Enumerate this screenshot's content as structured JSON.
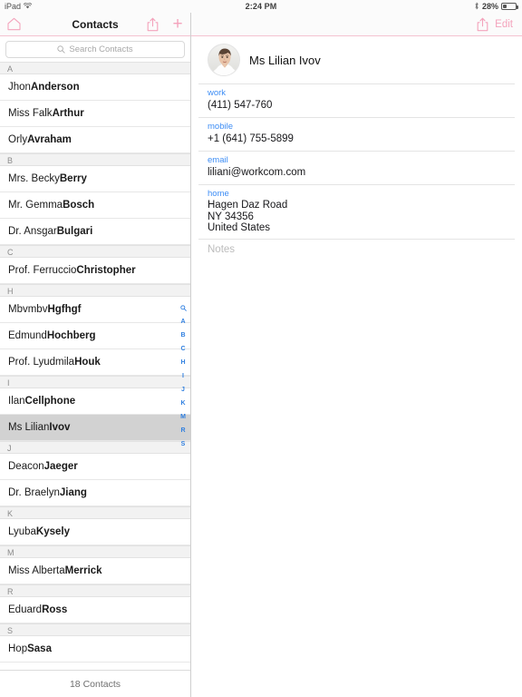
{
  "statusbar": {
    "device": "iPad",
    "wifi_icon": "wifi-icon",
    "time": "2:24 PM",
    "bluetooth_icon": "bluetooth-icon",
    "battery_percent": "28%",
    "battery_level": 28
  },
  "master": {
    "navbar": {
      "home_icon": "home-icon",
      "title": "Contacts",
      "share_icon": "share-icon",
      "add_label": "+"
    },
    "search": {
      "icon": "search-icon",
      "placeholder": "Search Contacts"
    },
    "sections": [
      {
        "letter": "A",
        "contacts": [
          {
            "first": "Jhon ",
            "last": "Anderson",
            "selected": false
          },
          {
            "first": "Miss Falk ",
            "last": "Arthur",
            "selected": false
          },
          {
            "first": "Orly ",
            "last": "Avraham",
            "selected": false
          }
        ]
      },
      {
        "letter": "B",
        "contacts": [
          {
            "first": "Mrs. Becky ",
            "last": "Berry",
            "selected": false
          },
          {
            "first": "Mr. Gemma ",
            "last": "Bosch",
            "selected": false
          },
          {
            "first": "Dr. Ansgar ",
            "last": "Bulgari",
            "selected": false
          }
        ]
      },
      {
        "letter": "C",
        "contacts": [
          {
            "first": "Prof. Ferruccio ",
            "last": "Christopher",
            "selected": false
          }
        ]
      },
      {
        "letter": "H",
        "contacts": [
          {
            "first": "Mbvmbv ",
            "last": "Hgfhgf",
            "selected": false
          },
          {
            "first": "Edmund ",
            "last": "Hochberg",
            "selected": false
          },
          {
            "first": "Prof. Lyudmila ",
            "last": "Houk",
            "selected": false
          }
        ]
      },
      {
        "letter": "I",
        "contacts": [
          {
            "first": "Ilan ",
            "last": "Cellphone",
            "selected": false
          },
          {
            "first": "Ms Lilian ",
            "last": "Ivov",
            "selected": true
          }
        ]
      },
      {
        "letter": "J",
        "contacts": [
          {
            "first": "Deacon ",
            "last": "Jaeger",
            "selected": false
          },
          {
            "first": "Dr. Braelyn ",
            "last": "Jiang",
            "selected": false
          }
        ]
      },
      {
        "letter": "K",
        "contacts": [
          {
            "first": "Lyuba ",
            "last": "Kysely",
            "selected": false
          }
        ]
      },
      {
        "letter": "M",
        "contacts": [
          {
            "first": "Miss Alberta ",
            "last": "Merrick",
            "selected": false
          }
        ]
      },
      {
        "letter": "R",
        "contacts": [
          {
            "first": "Eduard ",
            "last": "Ross",
            "selected": false
          }
        ]
      },
      {
        "letter": "S",
        "contacts": [
          {
            "first": "Hop ",
            "last": "Sasa",
            "selected": false
          }
        ]
      }
    ],
    "index_strip": [
      "search-icon",
      "A",
      "B",
      "C",
      "H",
      "I",
      "J",
      "K",
      "M",
      "R",
      "S"
    ],
    "footer": "18 Contacts"
  },
  "detail": {
    "navbar": {
      "share_icon": "share-icon",
      "edit_label": "Edit"
    },
    "avatar": "contact-photo",
    "name": "Ms Lilian Ivov",
    "fields": [
      {
        "label": "work",
        "value": "(411) 547-760",
        "type": "phone"
      },
      {
        "label": "mobile",
        "value": "+1 (641) 755-5899",
        "type": "phone"
      },
      {
        "label": "email",
        "value": "liliani@workcom.com",
        "type": "email"
      }
    ],
    "address": {
      "label": "home",
      "lines": [
        "Hagen Daz Road",
        " NY 34356",
        "United States"
      ]
    },
    "notes": {
      "label": "Notes",
      "value": ""
    }
  },
  "colors": {
    "accent_pink": "#f4a3bc",
    "link_blue": "#3d8df5",
    "index_blue": "#2f7fe0",
    "selected_row": "#d2d2d2",
    "section_header_bg": "#f2f2f2"
  }
}
